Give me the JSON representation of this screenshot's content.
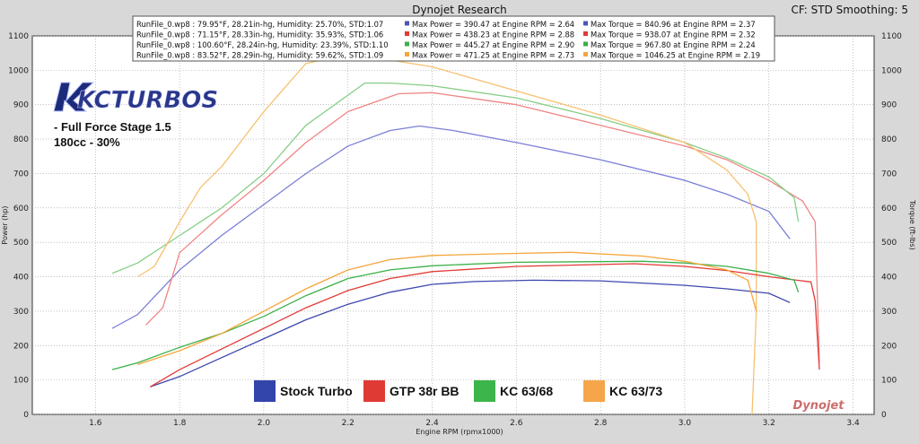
{
  "header": {
    "title": "Dynojet Research",
    "right_info": "CF: STD Smoothing: 5"
  },
  "brand": {
    "logo_text": "KCTURBOS",
    "note_line1": "- Full Force Stage 1.5",
    "note_line2": "180cc - 30%"
  },
  "legend_rows": [
    {
      "run": "RunFile_0.wp8 : 79.95°F, 28.21in-hg, Humidity: 25.70%, STD:1.07",
      "power": "Max Power = 390.47 at Engine RPM = 2.64",
      "torque": "Max Torque = 840.96 at Engine RPM = 2.37",
      "color": "#4a55b8"
    },
    {
      "run": "RunFile_0.wp8 : 71.15°F, 28.33in-hg, Humidity: 35.93%, STD:1.06",
      "power": "Max Power = 438.23 at Engine RPM = 2.88",
      "torque": "Max Torque = 938.07 at Engine RPM = 2.32",
      "color": "#e23a36"
    },
    {
      "run": "RunFile_0.wp8 : 100.60°F, 28.24in-hg, Humidity: 23.39%, STD:1.10",
      "power": "Max Power = 445.27 at Engine RPM = 2.90",
      "torque": "Max Torque = 967.80 at Engine RPM = 2.24",
      "color": "#3cb04a"
    },
    {
      "run": "RunFile_0.wp8 : 83.52°F, 28.29in-hg, Humidity: 59.62%, STD:1.09",
      "power": "Max Power = 471.25 at Engine RPM = 2.73",
      "torque": "Max Torque = 1046.25 at Engine RPM = 2.19",
      "color": "#f5a53a"
    }
  ],
  "bottom_legend": [
    {
      "label": "Stock Turbo",
      "color": "#3344aa"
    },
    {
      "label": "GTP 38r BB",
      "color": "#e03a34"
    },
    {
      "label": "KC 63/68",
      "color": "#3cb54a"
    },
    {
      "label": "KC 63/73",
      "color": "#f5a64a"
    }
  ],
  "watermark": "Dynojet",
  "chart_data": {
    "type": "line",
    "title": "Dynojet Research",
    "xlabel": "Engine RPM (rpmx1000)",
    "ylabel": "Power (hp)",
    "y2label": "Torque (ft-lbs)",
    "xlim": [
      1.45,
      3.45
    ],
    "ylim": [
      0,
      1100
    ],
    "y2lim": [
      0,
      1100
    ],
    "x_ticks": [
      "1.6",
      "1.8",
      "2.0",
      "2.2",
      "2.4",
      "2.6",
      "2.8",
      "3.0",
      "3.2",
      "3.4"
    ],
    "y_ticks": [
      "0",
      "100",
      "200",
      "300",
      "400",
      "500",
      "600",
      "700",
      "800",
      "900",
      "1000",
      "1100"
    ],
    "grid": true,
    "series": [
      {
        "name": "Stock Turbo",
        "kind": "torque",
        "color": "#7b7fd6",
        "x": [
          1.64,
          1.7,
          1.8,
          1.9,
          2.0,
          2.1,
          2.2,
          2.3,
          2.37,
          2.45,
          2.6,
          2.8,
          3.0,
          3.1,
          3.2,
          3.25
        ],
        "y": [
          250,
          290,
          420,
          520,
          610,
          700,
          780,
          825,
          838,
          825,
          790,
          740,
          680,
          640,
          590,
          510
        ]
      },
      {
        "name": "GTP 38r BB",
        "kind": "torque",
        "color": "#f08585",
        "x": [
          1.72,
          1.76,
          1.8,
          1.9,
          2.0,
          2.1,
          2.2,
          2.32,
          2.4,
          2.6,
          2.8,
          3.0,
          3.1,
          3.2,
          3.28,
          3.31,
          3.32
        ],
        "y": [
          260,
          310,
          470,
          580,
          680,
          790,
          880,
          932,
          935,
          900,
          840,
          780,
          740,
          680,
          620,
          560,
          150
        ]
      },
      {
        "name": "KC 63/68",
        "kind": "torque",
        "color": "#86ce86",
        "x": [
          1.64,
          1.7,
          1.8,
          1.9,
          2.0,
          2.1,
          2.24,
          2.3,
          2.4,
          2.6,
          2.8,
          3.0,
          3.1,
          3.2,
          3.26,
          3.27
        ],
        "y": [
          410,
          440,
          520,
          600,
          700,
          840,
          963,
          963,
          955,
          920,
          860,
          790,
          745,
          690,
          630,
          560
        ]
      },
      {
        "name": "KC 63/73",
        "kind": "torque",
        "color": "#f8c070",
        "x": [
          1.7,
          1.74,
          1.8,
          1.85,
          1.9,
          2.0,
          2.1,
          2.19,
          2.3,
          2.4,
          2.6,
          2.8,
          3.0,
          3.1,
          3.15,
          3.17,
          3.17,
          3.16
        ],
        "y": [
          400,
          430,
          560,
          660,
          720,
          880,
          1020,
          1043,
          1030,
          1010,
          940,
          870,
          790,
          710,
          640,
          560,
          300,
          0
        ]
      },
      {
        "name": "Stock Turbo",
        "kind": "power",
        "color": "#3e48b0",
        "x": [
          1.73,
          1.8,
          1.9,
          2.0,
          2.1,
          2.2,
          2.3,
          2.4,
          2.5,
          2.64,
          2.8,
          3.0,
          3.1,
          3.2,
          3.25
        ],
        "y": [
          80,
          110,
          165,
          220,
          275,
          320,
          355,
          378,
          386,
          390,
          388,
          375,
          365,
          352,
          325
        ]
      },
      {
        "name": "GTP 38r BB",
        "kind": "power",
        "color": "#e23a36",
        "x": [
          1.73,
          1.8,
          1.9,
          2.0,
          2.1,
          2.2,
          2.3,
          2.4,
          2.6,
          2.88,
          3.0,
          3.1,
          3.2,
          3.3,
          3.31,
          3.32
        ],
        "y": [
          80,
          130,
          190,
          250,
          310,
          360,
          395,
          415,
          430,
          438,
          430,
          418,
          400,
          385,
          330,
          130
        ]
      },
      {
        "name": "KC 63/68",
        "kind": "power",
        "color": "#3cb04a",
        "x": [
          1.64,
          1.7,
          1.8,
          1.9,
          2.0,
          2.1,
          2.2,
          2.3,
          2.4,
          2.6,
          2.9,
          3.0,
          3.1,
          3.2,
          3.26,
          3.27
        ],
        "y": [
          130,
          150,
          195,
          235,
          285,
          345,
          395,
          420,
          432,
          442,
          445,
          440,
          430,
          410,
          390,
          355
        ]
      },
      {
        "name": "KC 63/73",
        "kind": "power",
        "color": "#f5a53a",
        "x": [
          1.7,
          1.8,
          1.9,
          2.0,
          2.1,
          2.2,
          2.3,
          2.4,
          2.6,
          2.73,
          2.9,
          3.0,
          3.1,
          3.15,
          3.17
        ],
        "y": [
          145,
          185,
          235,
          300,
          365,
          420,
          450,
          462,
          468,
          471,
          460,
          445,
          420,
          390,
          300
        ]
      }
    ]
  }
}
